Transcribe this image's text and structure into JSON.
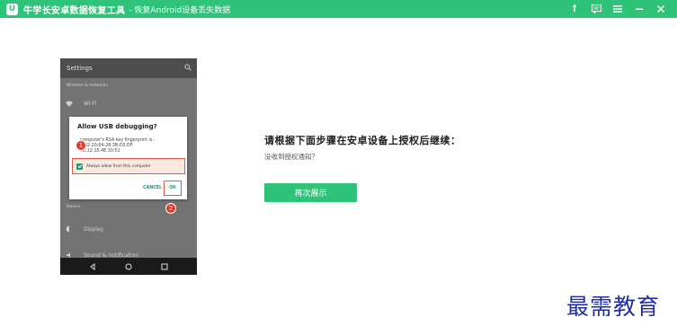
{
  "app": {
    "logo_letter": "U",
    "title": "牛学长安卓数据恢复工具",
    "subtitle": "- 恢复Android设备丢失数据",
    "controls": [
      "f",
      "☐",
      "≡",
      "−",
      "✕"
    ]
  },
  "phone": {
    "header_title": "Settings",
    "section_wireless": "Wireless & networks",
    "wifi_label": "Wi-Fi",
    "section_device": "Device",
    "display_label": "Display",
    "sound_label": "Sound & notification",
    "dialog": {
      "title": "Allow USB debugging?",
      "body_line1": "computer's RSA key fingerprint is:",
      "body_line2": "C:32:20:64:28:3B:C6:DF:",
      "body_line3": "43:12:15:4E:10:51",
      "checkbox_label": "Always allow from this computer",
      "cancel": "CANCEL",
      "ok": "OK"
    },
    "step1": "1",
    "step2": "2"
  },
  "content": {
    "instruction_title": "请根据下面步骤在安卓设备上授权后继续：",
    "instruction_sub": "没收到授权通知？",
    "retry_button": "再次展示"
  },
  "watermark": "最需教育",
  "colors": {
    "brand_green": "#2fc37a",
    "highlight_red": "#e05848",
    "badge_red": "#e03a2e",
    "watermark_blue": "#1f2ea8"
  }
}
